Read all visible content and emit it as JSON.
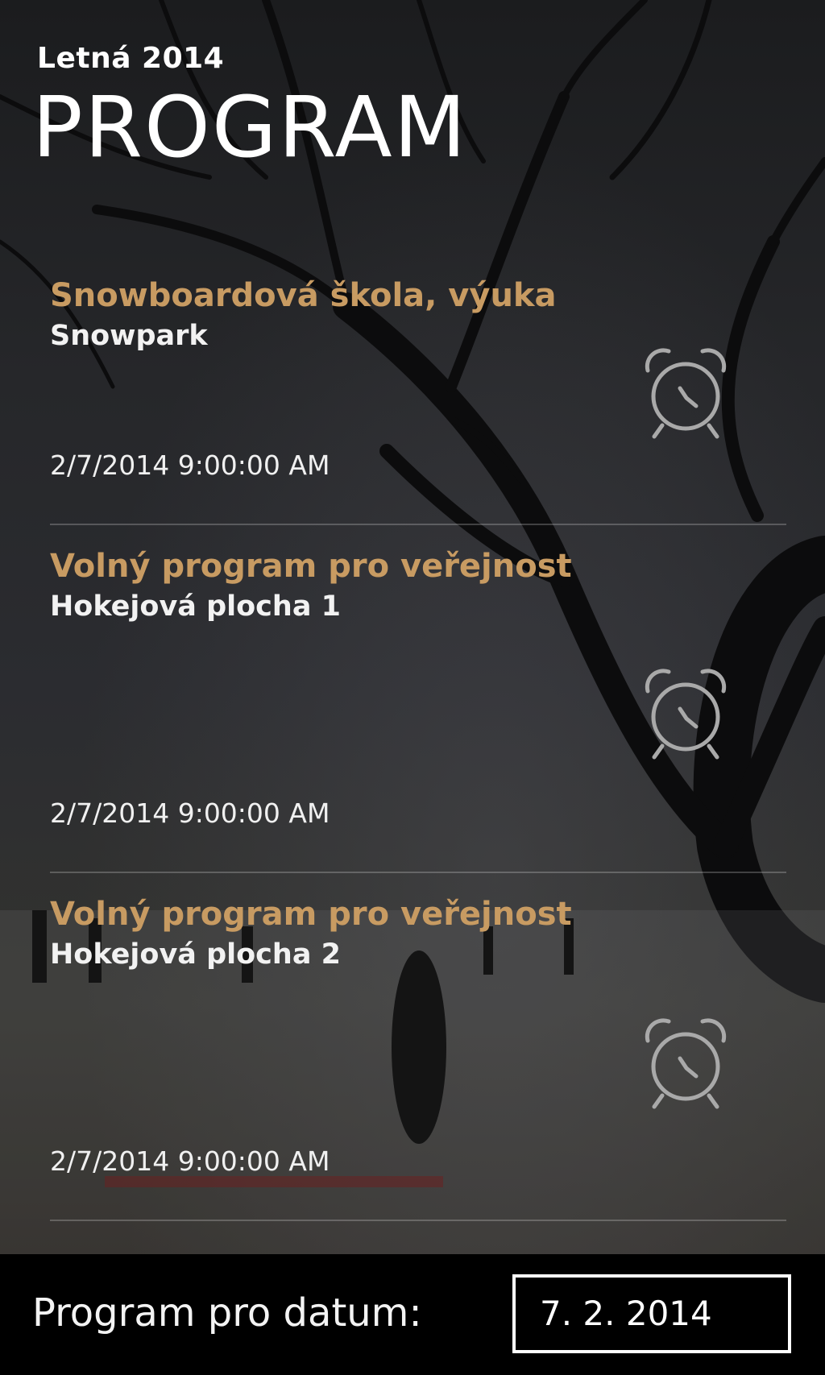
{
  "header": {
    "app_subtitle": "Letná 2014",
    "page_title": "PROGRAM"
  },
  "program_items": [
    {
      "title": "Snowboardová škola, výuka",
      "place": "Snowpark",
      "time": "2/7/2014 9:00:00 AM",
      "icon": "alarm-clock-icon"
    },
    {
      "title": "Volný program pro veřejnost",
      "place": "Hokejová plocha 1",
      "time": "2/7/2014 9:00:00 AM",
      "icon": "alarm-clock-icon"
    },
    {
      "title": "Volný program pro veřejnost",
      "place": "Hokejová plocha 2",
      "time": "2/7/2014 9:00:00 AM",
      "icon": "alarm-clock-icon"
    }
  ],
  "footer": {
    "date_label": "Program pro datum:",
    "date_value": "7. 2. 2014"
  },
  "colors": {
    "accent_title": "#c89b62",
    "text": "#ffffff",
    "background_bar": "#000000"
  }
}
